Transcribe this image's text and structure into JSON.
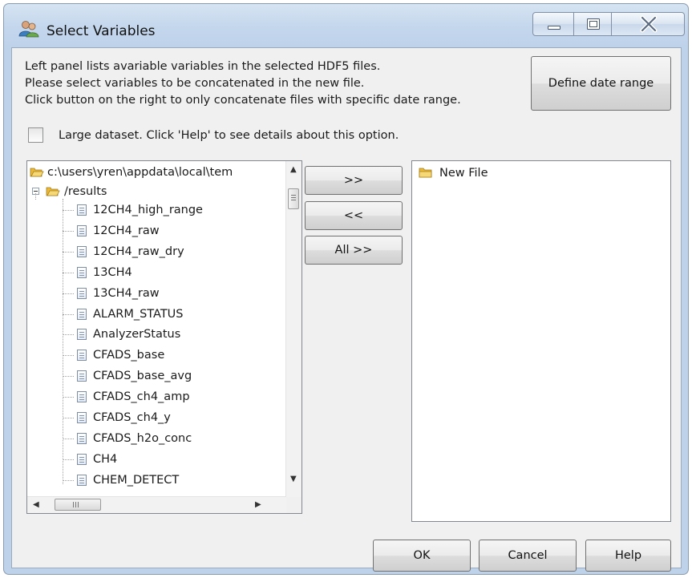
{
  "window": {
    "title": "Select Variables",
    "icon": "users-icon"
  },
  "caption_buttons": [
    "minimize-icon",
    "maximize-icon",
    "close-icon"
  ],
  "instructions": [
    "Left panel lists avariable variables in the selected HDF5 files.",
    "Please select variables to be concatenated in the new file.",
    "Click button on the right to only concatenate files with specific date range."
  ],
  "define_date_range_label": "Define date range",
  "large_dataset": {
    "checked": false,
    "label": "Large dataset. Click 'Help' to see details about this option."
  },
  "tree": {
    "root": "c:\\users\\yren\\appdata\\local\\tem",
    "group": "/results",
    "items": [
      "12CH4_high_range",
      "12CH4_raw",
      "12CH4_raw_dry",
      "13CH4",
      "13CH4_raw",
      "ALARM_STATUS",
      "AnalyzerStatus",
      "CFADS_base",
      "CFADS_base_avg",
      "CFADS_ch4_amp",
      "CFADS_ch4_y",
      "CFADS_h2o_conc",
      "CH4",
      "CHEM_DETECT"
    ]
  },
  "transfer_buttons": {
    "add": ">>",
    "remove": "<<",
    "add_all": "All >>"
  },
  "new_file_label": "New File",
  "dialog_buttons": {
    "ok": "OK",
    "cancel": "Cancel",
    "help": "Help"
  },
  "colors": {
    "folder": "#e8b93a",
    "title_bar": "#c3d6ec",
    "client_bg": "#f0f0f0"
  }
}
